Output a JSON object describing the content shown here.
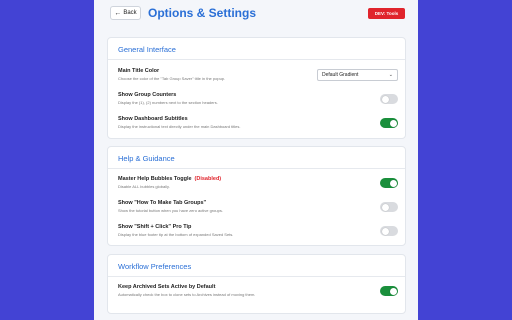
{
  "header": {
    "back_label": "Back",
    "back_icon": "arrow-left-icon",
    "title": "Options & Settings",
    "dev_tools_label": "DEV: Tools"
  },
  "colors": {
    "background": "#4343d4",
    "accent": "#2a6fd6",
    "toggle_on": "#1a8f3c",
    "toggle_off": "#d9dbdf",
    "danger": "#e0242c"
  },
  "sections": [
    {
      "title": "General Interface",
      "rows": [
        {
          "label": "Main Title Color",
          "desc": "Choose the color of the \"Tab Group Saver\" title in the popup.",
          "control": "select",
          "value": "Default Gradient"
        },
        {
          "label": "Show Group Counters",
          "desc": "Display the (1), (2) numbers next to the section headers.",
          "control": "toggle",
          "on": false
        },
        {
          "label": "Show Dashboard Subtitles",
          "desc": "Display the instructional text directly under the main Dashboard titles.",
          "control": "toggle",
          "on": true
        }
      ]
    },
    {
      "title": "Help & Guidance",
      "rows": [
        {
          "label": "Master Help Bubbles Toggle",
          "tag": "(Disabled)",
          "desc": "Disable ALL bubbles globally.",
          "control": "toggle",
          "on": true
        },
        {
          "label": "Show \"How To Make Tab Groups\"",
          "desc": "Show the tutorial button when you have zero active groups.",
          "control": "toggle",
          "on": false
        },
        {
          "label": "Show \"Shift + Click\" Pro Tip",
          "desc": "Display the blue footer tip at the bottom of expanded Saved Sets.",
          "control": "toggle",
          "on": false
        }
      ]
    },
    {
      "title": "Workflow Preferences",
      "rows": [
        {
          "label": "Keep Archived Sets Active by Default",
          "desc": "Automatically check the box to clone sets to Archives instead of moving them.",
          "control": "toggle",
          "on": true
        }
      ]
    }
  ]
}
